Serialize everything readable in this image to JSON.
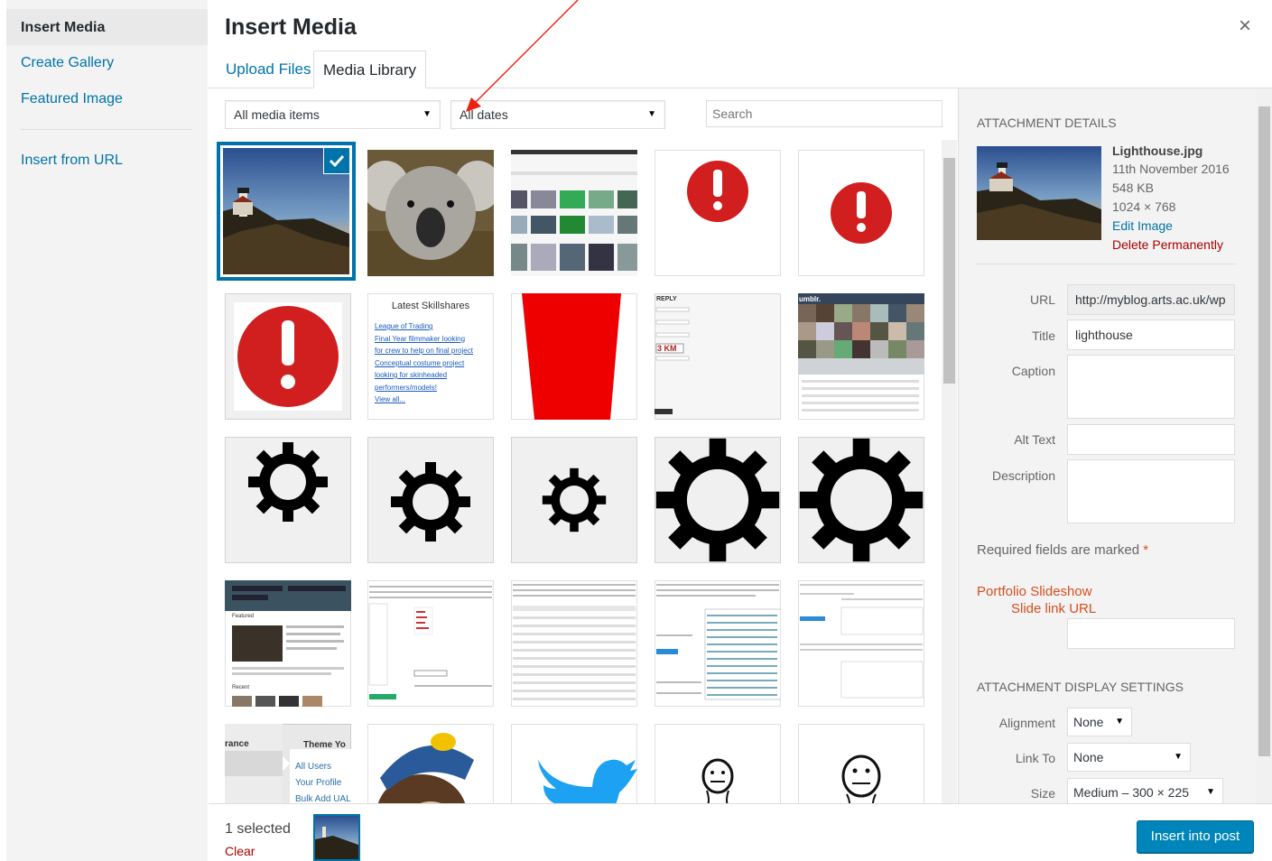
{
  "menu": {
    "active": "Insert Media",
    "items": [
      "Create Gallery",
      "Featured Image"
    ],
    "url_item": "Insert from URL"
  },
  "header": {
    "title": "Insert Media",
    "close_icon": "×",
    "tabs": [
      "Upload Files",
      "Media Library"
    ]
  },
  "toolbar": {
    "media_filter": "All media items",
    "date_filter": "All dates",
    "search_placeholder": "Search"
  },
  "grid_text": {
    "latest_title": "Latest Skillshares",
    "latest_links": [
      "League of Trading",
      "Final Year filmmaker looking",
      "for crew to help on final project",
      "Conceptual costume project",
      "looking for skinheaded",
      "performers/models!",
      "View all..."
    ],
    "tumblr": "umblr.",
    "featured_label": "Featured",
    "recent_label": "Recent",
    "arance": "rance",
    "theme": "Theme Yo",
    "users_menu": [
      "All Users",
      "Your Profile",
      "Bulk Add UAL"
    ]
  },
  "details": {
    "heading": "Attachment Details",
    "filename": "Lighthouse.jpg",
    "date": "11th November 2016",
    "size": "548 KB",
    "dimensions": "1024 × 768",
    "edit": "Edit Image",
    "delete": "Delete Permanently",
    "url_label": "URL",
    "url_value": "http://myblog.arts.ac.uk/wp",
    "title_label": "Title",
    "title_value": "lighthouse",
    "caption_label": "Caption",
    "alt_label": "Alt Text",
    "description_label": "Description",
    "required": "Required fields are marked",
    "required_mark": "*",
    "portfolio": "Portfolio Slideshow",
    "slide_link": "Slide link URL"
  },
  "display": {
    "heading": "Attachment Display Settings",
    "alignment_label": "Alignment",
    "alignment_value": "None",
    "link_label": "Link To",
    "link_value": "None",
    "size_label": "Size",
    "size_value": "Medium – 300 × 225"
  },
  "footer": {
    "selected": "1 selected",
    "clear": "Clear",
    "insert": "Insert into post"
  },
  "colors": {
    "accent": "#0073aa",
    "danger": "#a00000",
    "button": "#0085ba",
    "alert_red": "#d11f1f"
  }
}
